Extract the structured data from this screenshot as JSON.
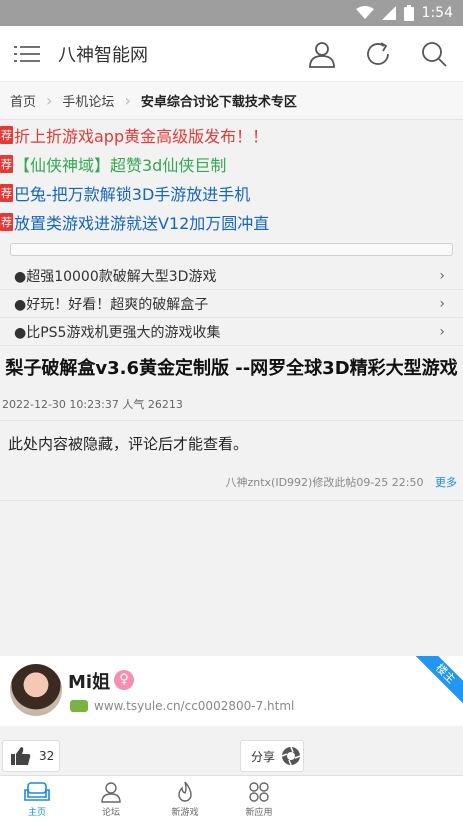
{
  "status": {
    "time": "1:54"
  },
  "header": {
    "title": "八神智能网"
  },
  "breadcrumb": {
    "home": "首页",
    "forum": "手机论坛",
    "current": "安卓综合讨论下载技术专区"
  },
  "promos": [
    {
      "tag": "荐",
      "text": "折上折游戏app黄金高级版发布！！"
    },
    {
      "tag": "荐",
      "text": "【仙侠神域】超赞3d仙侠巨制"
    },
    {
      "tag": "荐",
      "text": "巴兔-把万款解锁3D手游放进手机"
    },
    {
      "tag": "荐",
      "text": "放置类游戏进游就送V12加万圆冲直"
    }
  ],
  "links": [
    {
      "text": "●超强10000款破解大型3D游戏",
      "chev": "›"
    },
    {
      "text": "●好玩！好看！超爽的破解盒子",
      "chev": "›"
    },
    {
      "text": "●比PS5游戏机更强大的游戏收集",
      "chev": "›"
    }
  ],
  "post": {
    "title": "梨子破解盒v3.6黄金定制版 --网罗全球3D精彩大型游戏",
    "meta": "2022-12-30 10:23:37  人气 26213",
    "body": "此处内容被隐藏，评论后才能查看。",
    "edit_note": "八神zntx(ID992)修改此帖09-25 22:50",
    "more": "更多"
  },
  "user": {
    "name": "Mi姐",
    "gender": "♀",
    "url": "www.tsyule.cn/cc0002800-7.html",
    "floor": "楼主"
  },
  "actions": {
    "likes": "32",
    "share": "分享"
  },
  "tabs": [
    {
      "label": "主页"
    },
    {
      "label": "论坛"
    },
    {
      "label": "新游戏"
    },
    {
      "label": "新应用"
    }
  ]
}
